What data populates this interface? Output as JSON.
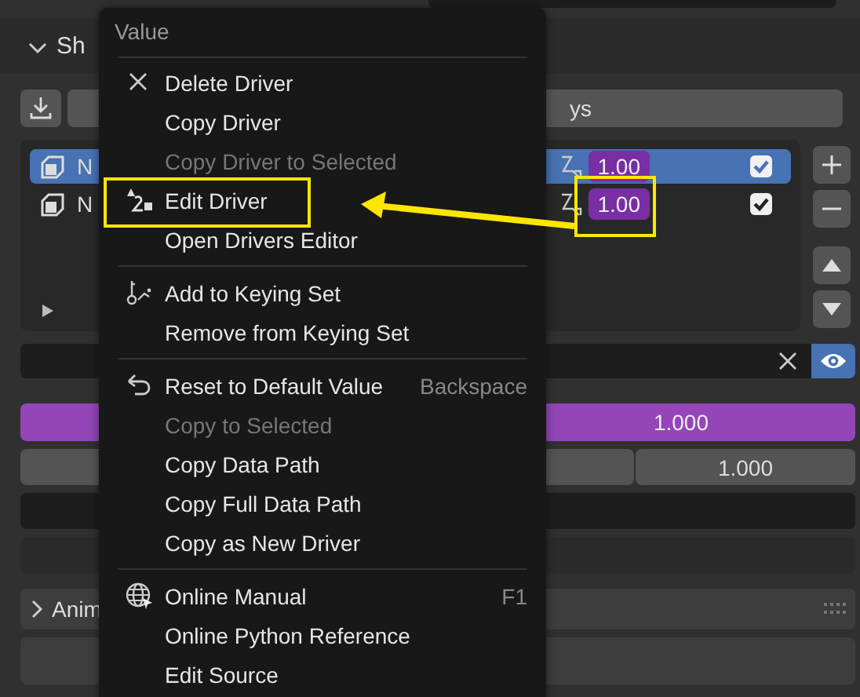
{
  "properties": {
    "subpanel": {
      "label": "Sh",
      "expanded": true
    },
    "toolbar": {
      "button_label": "ys"
    },
    "shape_keys": [
      {
        "name": "N",
        "value": "1.00",
        "selected": true,
        "checked": true
      },
      {
        "name": "N",
        "value": "1.00",
        "selected": false,
        "checked": true
      }
    ],
    "filter": {
      "visible": true
    },
    "value_field": {
      "value": "1.000"
    },
    "range_fields": [
      {
        "kind": "number"
      },
      {
        "kind": "number",
        "value": "1.000"
      }
    ],
    "panels": [
      {
        "label": "Anim",
        "expanded": false
      }
    ]
  },
  "context_menu": {
    "title": "Value",
    "sections": [
      {
        "items": [
          {
            "label": "Delete Driver",
            "disabled": false
          },
          {
            "label": "Copy Driver",
            "disabled": false
          },
          {
            "label": "Copy Driver to Selected",
            "disabled": true
          },
          {
            "label": "Edit Driver",
            "disabled": false
          },
          {
            "label": "Open Drivers Editor",
            "disabled": false
          }
        ]
      },
      {
        "items": [
          {
            "label": "Add to Keying Set",
            "disabled": false
          },
          {
            "label": "Remove from Keying Set",
            "disabled": false
          }
        ]
      },
      {
        "items": [
          {
            "label": "Reset to Default Value",
            "disabled": false,
            "shortcut": "Backspace"
          },
          {
            "label": "Copy to Selected",
            "disabled": true
          },
          {
            "label": "Copy Data Path",
            "disabled": false
          },
          {
            "label": "Copy Full Data Path",
            "disabled": false
          },
          {
            "label": "Copy as New Driver",
            "disabled": false
          }
        ]
      },
      {
        "items": [
          {
            "label": "Online Manual",
            "disabled": false,
            "shortcut": "F1"
          },
          {
            "label": "Online Python Reference",
            "disabled": false
          },
          {
            "label": "Edit Source",
            "disabled": false
          }
        ]
      }
    ]
  }
}
